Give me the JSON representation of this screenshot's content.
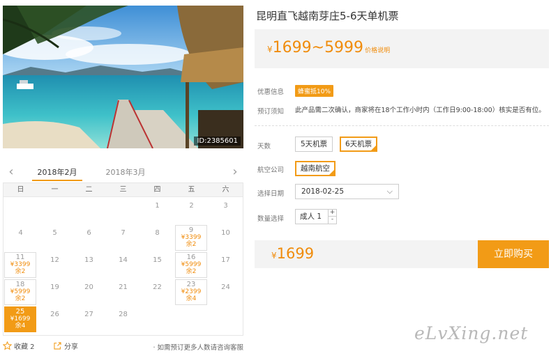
{
  "hero": {
    "photo_id": "ID:2385601"
  },
  "product": {
    "title": "昆明直飞越南芽庄5-6天单机票",
    "currency": "¥",
    "price_range": "1699~5999",
    "price_note": "价格说明"
  },
  "discount": {
    "label": "优惠信息",
    "badge": "蜂蜜抵10%"
  },
  "booking": {
    "label": "预订须知",
    "text": "此产品需二次确认，商家将在18个工作小时内（工作日9:00-18:00）核实是否有位。"
  },
  "days": {
    "label": "天数",
    "options": [
      "5天机票",
      "6天机票"
    ],
    "selected": "6天机票"
  },
  "airline": {
    "label": "航空公司",
    "options": [
      "越南航空"
    ],
    "selected": "越南航空"
  },
  "date": {
    "label": "选择日期",
    "value": "2018-02-25"
  },
  "quantity": {
    "label": "数量选择",
    "value": "成人 1",
    "plus": "+",
    "minus": "-"
  },
  "buy": {
    "currency": "¥",
    "price": "1699",
    "button": "立即购买"
  },
  "calendar": {
    "prev_icon": "‹",
    "next_icon": "›",
    "months": [
      "2018年2月",
      "2018年3月"
    ],
    "active_month": "2018年2月",
    "weekdays": [
      "日",
      "一",
      "二",
      "三",
      "四",
      "五",
      "六"
    ],
    "weeks": [
      [
        {
          "day": ""
        },
        {
          "day": ""
        },
        {
          "day": ""
        },
        {
          "day": ""
        },
        {
          "day": "1"
        },
        {
          "day": "2"
        },
        {
          "day": "3"
        }
      ],
      [
        {
          "day": "4"
        },
        {
          "day": "5"
        },
        {
          "day": "6"
        },
        {
          "day": "7"
        },
        {
          "day": "8"
        },
        {
          "day": "9",
          "price": "¥3399",
          "remain": "余2"
        },
        {
          "day": "10"
        }
      ],
      [
        {
          "day": "11",
          "price": "¥3399",
          "remain": "余2"
        },
        {
          "day": "12"
        },
        {
          "day": "13"
        },
        {
          "day": "14"
        },
        {
          "day": "15"
        },
        {
          "day": "16",
          "price": "¥5999",
          "remain": "余2"
        },
        {
          "day": "17"
        }
      ],
      [
        {
          "day": "18",
          "price": "¥5999",
          "remain": "余2"
        },
        {
          "day": "19"
        },
        {
          "day": "20"
        },
        {
          "day": "21"
        },
        {
          "day": "22"
        },
        {
          "day": "23",
          "price": "¥2399",
          "remain": "余4"
        },
        {
          "day": "24"
        }
      ],
      [
        {
          "day": "25",
          "price": "¥1699",
          "remain": "余4",
          "selected": true
        },
        {
          "day": "26"
        },
        {
          "day": "27"
        },
        {
          "day": "28"
        },
        {
          "day": ""
        },
        {
          "day": ""
        },
        {
          "day": ""
        }
      ]
    ]
  },
  "actions": {
    "favorite": "收藏 2",
    "share": "分享",
    "consult": "· 如需预订更多人数请咨询客服"
  },
  "watermark": "eLvXing.net",
  "colors": {
    "accent": "#f29b16",
    "price": "#f08c0c",
    "panel": "#f3f3f3"
  },
  "icons": {
    "favorite": "star-icon",
    "share": "share-icon",
    "prev": "chevron-left-icon",
    "next": "chevron-right-icon",
    "dropdown": "chevron-down-icon"
  }
}
